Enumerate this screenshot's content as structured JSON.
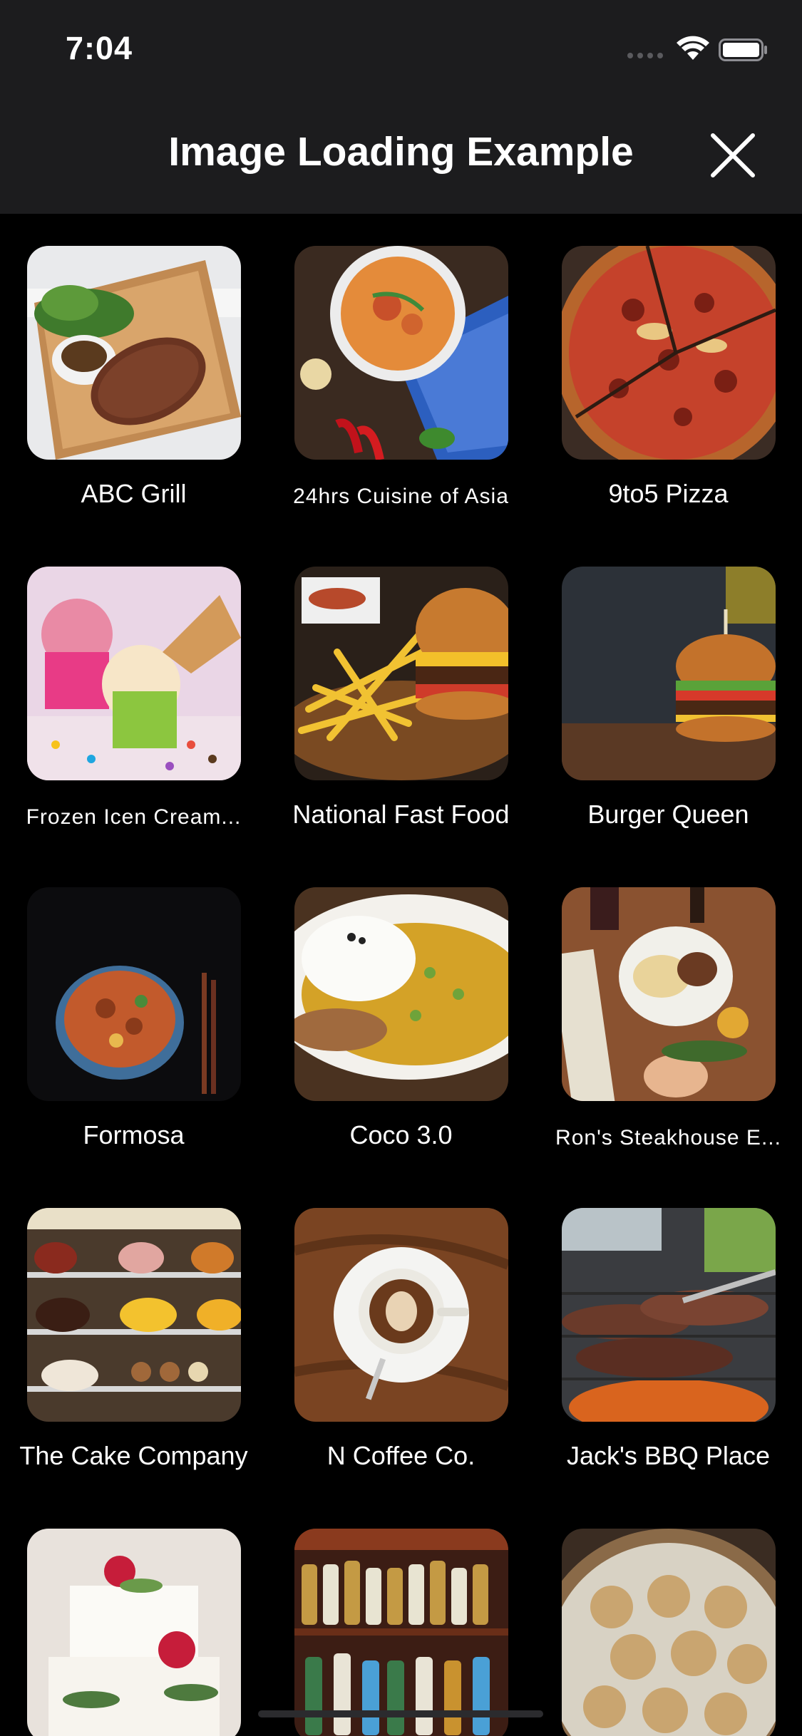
{
  "status_bar": {
    "time": "7:04"
  },
  "nav": {
    "title": "Image Loading Example",
    "close_icon": "close-icon"
  },
  "restaurants": [
    {
      "name": "ABC Grill",
      "image": "steak-board"
    },
    {
      "name": "24hrs Cuisine of Asia",
      "image": "curry-bowl"
    },
    {
      "name": "9to5 Pizza",
      "image": "pizza"
    },
    {
      "name": "Frozen Icen Cream...",
      "image": "ice-cream"
    },
    {
      "name": "National Fast Food",
      "image": "burger-fries"
    },
    {
      "name": "Burger Queen",
      "image": "burger"
    },
    {
      "name": "Formosa",
      "image": "noodle-soup"
    },
    {
      "name": "Coco 3.0",
      "image": "curry-rice"
    },
    {
      "name": "Ron's Steakhouse E...",
      "image": "steak-dinner"
    },
    {
      "name": "The Cake Company",
      "image": "cake-display"
    },
    {
      "name": "N Coffee Co.",
      "image": "coffee-cup"
    },
    {
      "name": "Jack's BBQ Place",
      "image": "bbq-grill"
    },
    {
      "name": "",
      "image": "wedding-cake"
    },
    {
      "name": "",
      "image": "liquor-shelf"
    },
    {
      "name": "",
      "image": "dumplings"
    }
  ],
  "colors": {
    "background": "#000000",
    "bar": "#1c1c1e",
    "text": "#ffffff"
  }
}
